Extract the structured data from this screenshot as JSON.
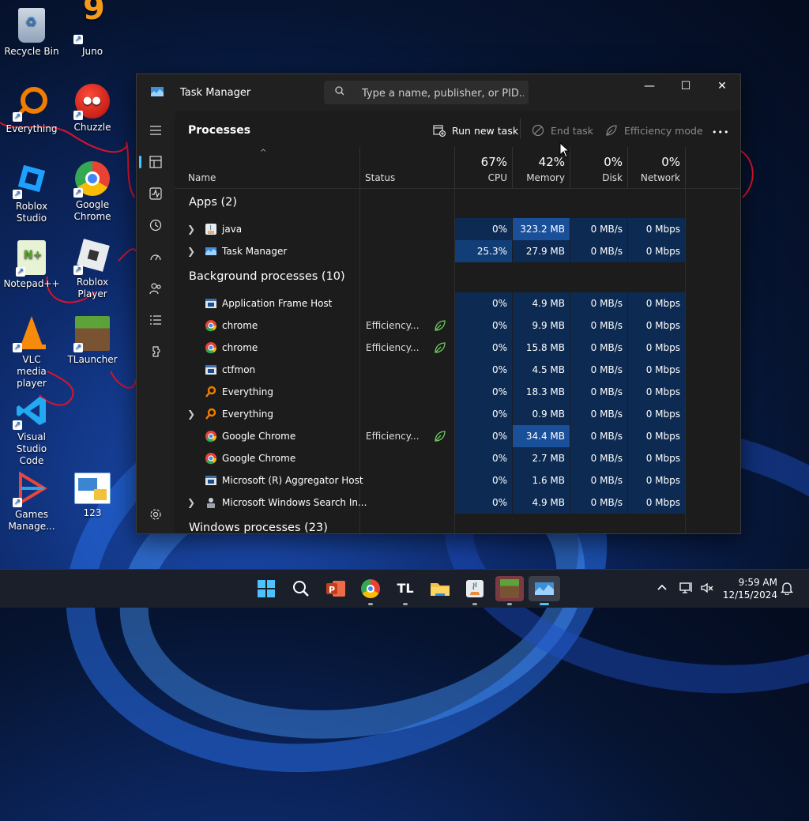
{
  "desktop": {
    "icons": [
      {
        "label": "Recycle Bin",
        "icon": "recycle-bin-icon"
      },
      {
        "label": "Juno",
        "icon": "juno-icon"
      },
      {
        "label": "Everything",
        "icon": "everything-icon"
      },
      {
        "label": "Chuzzle",
        "icon": "chuzzle-icon"
      },
      {
        "label": "Roblox Studio",
        "icon": "roblox-studio-icon"
      },
      {
        "label": "Google Chrome",
        "icon": "chrome-icon"
      },
      {
        "label": "Notepad++",
        "icon": "notepadpp-icon"
      },
      {
        "label": "Roblox Player",
        "icon": "roblox-player-icon"
      },
      {
        "label": "VLC media player",
        "icon": "vlc-icon"
      },
      {
        "label": "TLauncher",
        "icon": "tlauncher-icon"
      },
      {
        "label": "Visual Studio Code",
        "icon": "vscode-icon"
      },
      {
        "label": "Games Manage...",
        "icon": "games-manager-icon"
      },
      {
        "label": "123",
        "icon": "document-icon"
      }
    ]
  },
  "window": {
    "title": "Task Manager",
    "search_placeholder": "Type a name, publisher, or PID...",
    "controls": {
      "minimize": "—",
      "maximize": "☐",
      "close": "✕"
    }
  },
  "commandbar": {
    "title": "Processes",
    "run_new_task": "Run new task",
    "end_task": "End task",
    "efficiency_mode": "Efficiency mode",
    "more": "•••"
  },
  "header": {
    "name": "Name",
    "status": "Status",
    "cpu_pct": "67%",
    "cpu": "CPU",
    "memory_pct": "42%",
    "memory": "Memory",
    "disk_pct": "0%",
    "disk": "Disk",
    "network_pct": "0%",
    "network": "Network"
  },
  "groups": {
    "apps": "Apps (2)",
    "background": "Background processes (10)",
    "windows": "Windows processes (23)"
  },
  "apps": [
    {
      "name": "java",
      "icon": "java-icon",
      "expandable": true,
      "status": "",
      "cpu": "0%",
      "memory": "323.2 MB",
      "disk": "0 MB/s",
      "network": "0 Mbps"
    },
    {
      "name": "Task Manager",
      "icon": "task-manager-icon",
      "expandable": true,
      "status": "",
      "cpu": "25.3%",
      "memory": "27.9 MB",
      "disk": "0 MB/s",
      "network": "0 Mbps"
    }
  ],
  "background": [
    {
      "name": "Application Frame Host",
      "icon": "app-frame-icon",
      "expandable": false,
      "status": "",
      "cpu": "0%",
      "memory": "4.9 MB",
      "disk": "0 MB/s",
      "network": "0 Mbps"
    },
    {
      "name": "chrome",
      "icon": "chrome-icon",
      "expandable": false,
      "status": "Efficiency...",
      "cpu": "0%",
      "memory": "9.9 MB",
      "disk": "0 MB/s",
      "network": "0 Mbps"
    },
    {
      "name": "chrome",
      "icon": "chrome-icon",
      "expandable": false,
      "status": "Efficiency...",
      "cpu": "0%",
      "memory": "15.8 MB",
      "disk": "0 MB/s",
      "network": "0 Mbps"
    },
    {
      "name": "ctfmon",
      "icon": "app-frame-icon",
      "expandable": false,
      "status": "",
      "cpu": "0%",
      "memory": "4.5 MB",
      "disk": "0 MB/s",
      "network": "0 Mbps"
    },
    {
      "name": "Everything",
      "icon": "everything-icon",
      "expandable": false,
      "status": "",
      "cpu": "0%",
      "memory": "18.3 MB",
      "disk": "0 MB/s",
      "network": "0 Mbps"
    },
    {
      "name": "Everything",
      "icon": "everything-icon",
      "expandable": true,
      "status": "",
      "cpu": "0%",
      "memory": "0.9 MB",
      "disk": "0 MB/s",
      "network": "0 Mbps"
    },
    {
      "name": "Google Chrome",
      "icon": "chrome-icon",
      "expandable": false,
      "status": "Efficiency...",
      "cpu": "0%",
      "memory": "34.4 MB",
      "disk": "0 MB/s",
      "network": "0 Mbps"
    },
    {
      "name": "Google Chrome",
      "icon": "chrome-icon",
      "expandable": false,
      "status": "",
      "cpu": "0%",
      "memory": "2.7 MB",
      "disk": "0 MB/s",
      "network": "0 Mbps"
    },
    {
      "name": "Microsoft (R) Aggregator Host",
      "icon": "app-frame-icon",
      "expandable": false,
      "status": "",
      "cpu": "0%",
      "memory": "1.6 MB",
      "disk": "0 MB/s",
      "network": "0 Mbps"
    },
    {
      "name": "Microsoft Windows Search In...",
      "icon": "search-indexer-icon",
      "expandable": true,
      "status": "",
      "cpu": "0%",
      "memory": "4.9 MB",
      "disk": "0 MB/s",
      "network": "0 Mbps"
    }
  ],
  "taskbar": {
    "apps": [
      "windows-start-icon",
      "search-icon",
      "powerpoint-icon",
      "chrome-icon",
      "tlauncher-icon",
      "file-explorer-icon",
      "java-icon",
      "minecraft-icon",
      "task-manager-icon"
    ],
    "time": "9:59 AM",
    "date": "12/15/2024",
    "tl_text": "TL"
  },
  "colors": {
    "accent": "#4cc2ff",
    "heat_low": "#0d2b52",
    "heat_mid": "#123e78",
    "heat_high": "#1a4f9a",
    "efficiency_leaf": "#6ccb5f"
  }
}
